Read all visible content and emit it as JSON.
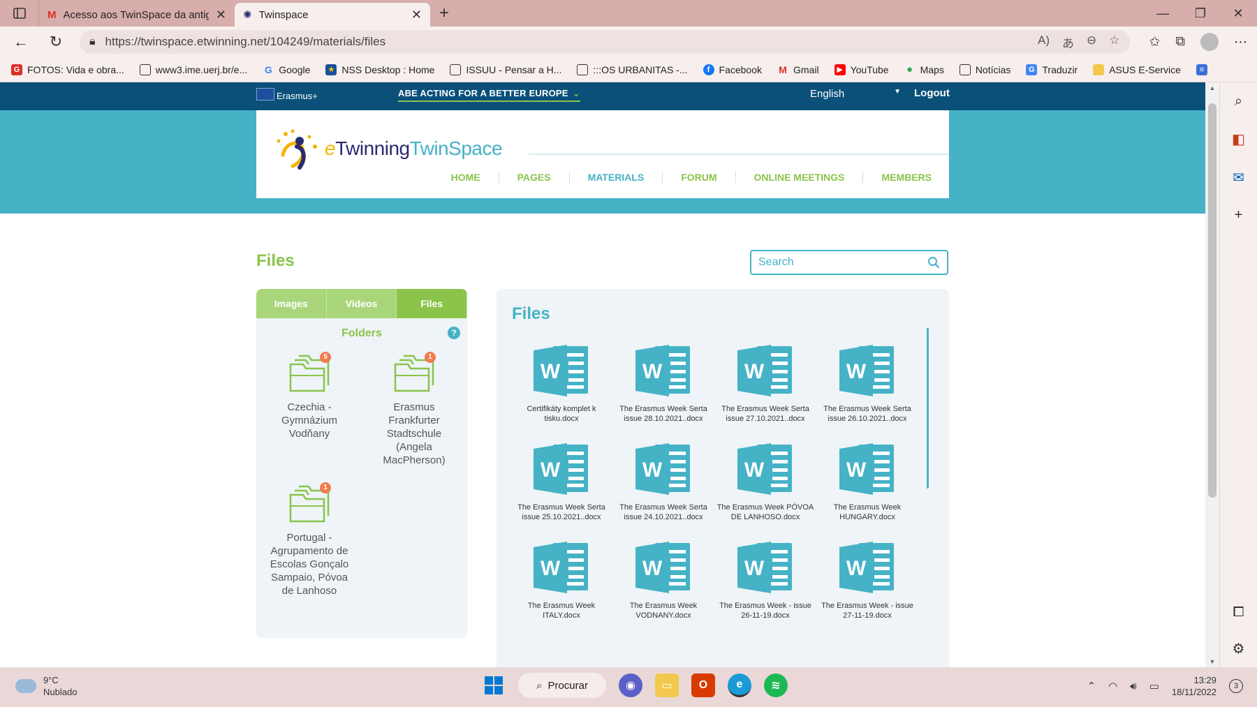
{
  "browser": {
    "tabs": [
      {
        "title": "Acesso aos TwinSpace da antiga",
        "active": false
      },
      {
        "title": "Twinspace",
        "active": true
      }
    ],
    "url": "https://twinspace.etwinning.net/104249/materials/files",
    "bookmarks": [
      {
        "label": "FOTOS: Vida e obra...",
        "icon": "red-square-icon"
      },
      {
        "label": "www3.ime.uerj.br/e...",
        "icon": "page-icon"
      },
      {
        "label": "Google",
        "icon": "google-icon"
      },
      {
        "label": "NSS Desktop : Home",
        "icon": "eu-flag-icon"
      },
      {
        "label": "ISSUU - Pensar a H...",
        "icon": "page-icon"
      },
      {
        "label": ":::OS URBANITAS -...",
        "icon": "page-icon"
      },
      {
        "label": "Facebook",
        "icon": "facebook-icon"
      },
      {
        "label": "Gmail",
        "icon": "gmail-icon"
      },
      {
        "label": "YouTube",
        "icon": "youtube-icon"
      },
      {
        "label": "Maps",
        "icon": "maps-icon"
      },
      {
        "label": "Notícias",
        "icon": "page-icon"
      },
      {
        "label": "Traduzir",
        "icon": "translate-icon"
      },
      {
        "label": "ASUS E-Service",
        "icon": "folder-icon"
      }
    ]
  },
  "site": {
    "erasmus": "Erasmus+",
    "project_title": "ABE ACTING FOR A BETTER EUROPE",
    "language": "English",
    "logout": "Logout",
    "logo": {
      "e": "e",
      "twinning": "Twinning",
      "twinspace": "TwinSpace"
    },
    "nav": [
      "HOME",
      "PAGES",
      "MATERIALS",
      "FORUM",
      "ONLINE MEETINGS",
      "MEMBERS"
    ],
    "nav_active": "MATERIALS"
  },
  "page": {
    "title": "Files",
    "search_placeholder": "Search",
    "tabs": [
      "Images",
      "Videos",
      "Files"
    ],
    "active_tab": "Files",
    "folders_heading": "Folders",
    "help": "?",
    "folders": [
      {
        "name": "Czechia - Gymnázium Vodňany",
        "count": "5"
      },
      {
        "name": "Erasmus Frankfurter Stadtschule (Angela MacPherson)",
        "count": "1"
      },
      {
        "name": "Portugal - Agrupamento de Escolas Gonçalo Sampaio, Póvoa de Lanhoso",
        "count": "1"
      }
    ],
    "files_heading": "Files",
    "files": [
      "Certifikáty komplet k tisku.docx",
      "The Erasmus Week Serta issue 28.10.2021..docx",
      "The Erasmus Week Serta issue 27.10.2021..docx",
      "The Erasmus Week Serta issue 26.10.2021..docx",
      "The Erasmus Week Serta issue 25.10.2021..docx",
      "The Erasmus Week Serta issue 24.10.2021..docx",
      "The Erasmus Week PÓVOA DE LANHOSO.docx",
      "The Erasmus Week HUNGARY.docx",
      "The Erasmus Week ITALY.docx",
      "The Erasmus Week VODNANY.docx",
      "The Erasmus Week - issue 26-11-19.docx",
      "The Erasmus Week - issue 27-11-19.docx"
    ]
  },
  "taskbar": {
    "temperature": "9°C",
    "weather": "Nublado",
    "search": "Procurar",
    "time": "13:29",
    "date": "18/11/2022",
    "notifications": "3"
  },
  "colors": {
    "green": "#8ac44a",
    "teal": "#45b2c6",
    "navy": "#0a5079"
  }
}
